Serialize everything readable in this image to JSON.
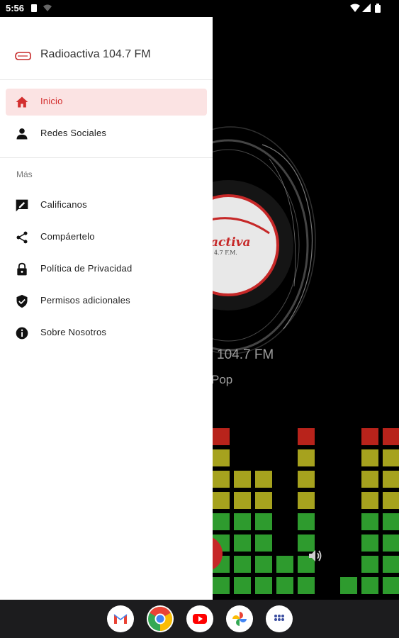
{
  "status_bar": {
    "time": "5:56"
  },
  "drawer": {
    "title": "Radioactiva 104.7 FM",
    "items": [
      {
        "label": "Inicio",
        "icon": "home-icon",
        "active": true
      },
      {
        "label": "Redes Sociales",
        "icon": "person-icon",
        "active": false
      }
    ],
    "section_label": "Más",
    "more_items": [
      {
        "label": "Calificanos",
        "icon": "rate-review-icon"
      },
      {
        "label": "Compáertelo",
        "icon": "share-icon"
      },
      {
        "label": "Política de Privacidad",
        "icon": "lock-icon"
      },
      {
        "label": "Permisos adicionales",
        "icon": "shield-icon"
      },
      {
        "label": "Sobre Nosotros",
        "icon": "info-icon"
      }
    ]
  },
  "player": {
    "station_name": "104.7 FM",
    "genre": "Pop",
    "logo_text": "activa",
    "logo_subtext": "4.7 F.M."
  },
  "nav_bar": {
    "apps": [
      "gmail-icon",
      "chrome-icon",
      "youtube-icon",
      "photos-icon",
      "app-drawer-icon"
    ]
  },
  "colors": {
    "accent": "#d32f2f",
    "active_bg": "#fbe3e3",
    "eq_green": "#2e9b2e",
    "eq_yellow": "#a6a21e",
    "eq_red": "#b8231b"
  }
}
